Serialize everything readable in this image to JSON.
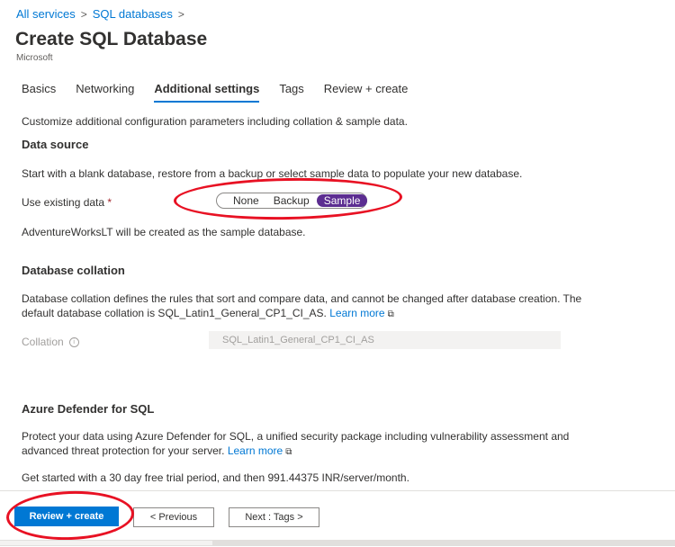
{
  "breadcrumb": {
    "items": [
      "All services",
      "SQL databases"
    ],
    "separator": ">"
  },
  "page": {
    "title": "Create SQL Database",
    "subtitle": "Microsoft"
  },
  "tabs": [
    {
      "label": "Basics",
      "active": false
    },
    {
      "label": "Networking",
      "active": false
    },
    {
      "label": "Additional settings",
      "active": true
    },
    {
      "label": "Tags",
      "active": false
    },
    {
      "label": "Review + create",
      "active": false
    }
  ],
  "intro": "Customize additional configuration parameters including collation & sample data.",
  "data_source": {
    "title": "Data source",
    "description": "Start with a blank database, restore from a backup or select sample data to populate your new database.",
    "field_label": "Use existing data",
    "required_mark": "*",
    "options": [
      "None",
      "Backup",
      "Sample"
    ],
    "selected": "Sample",
    "note": "AdventureWorksLT will be created as the sample database."
  },
  "collation": {
    "title": "Database collation",
    "description_line1": "Database collation defines the rules that sort and compare data, and cannot be changed after database creation. The",
    "description_line2": "default database collation is SQL_Latin1_General_CP1_CI_AS.",
    "learn_more": "Learn more",
    "field_label": "Collation",
    "value": "SQL_Latin1_General_CP1_CI_AS"
  },
  "defender": {
    "title": "Azure Defender for SQL",
    "description_line1": "Protect your data using Azure Defender for SQL, a unified security package including vulnerability assessment and",
    "description_line2": "advanced threat protection for your server.",
    "learn_more": "Learn more",
    "trial": "Get started with a 30 day free trial period, and then 991.44375 INR/server/month."
  },
  "footer": {
    "review_create": "Review + create",
    "previous": "< Previous",
    "next": "Next : Tags >"
  },
  "colors": {
    "accent": "#0078d4",
    "segment_selected": "#5c2d91",
    "annotation": "#e81123"
  },
  "icons": {
    "info": "info-icon",
    "external_link": "external-link-icon"
  }
}
